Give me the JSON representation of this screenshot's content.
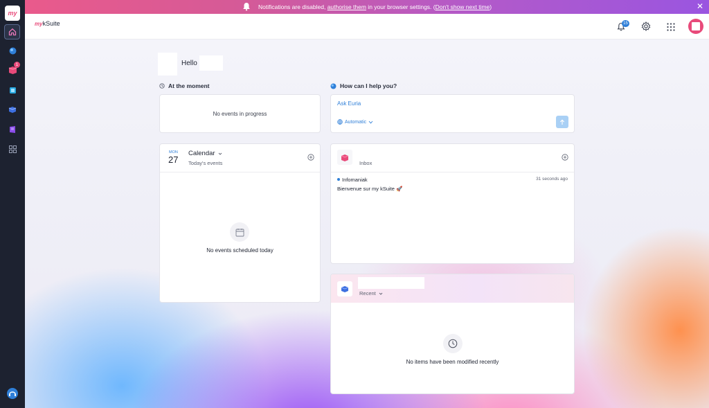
{
  "banner": {
    "text_before": "Notifications are disabled, ",
    "link_authorise": "authorise them",
    "text_middle": " in your browser settings. (",
    "link_dont_show": "Don't show next time",
    "text_after": ")"
  },
  "sidebar": {
    "notification_count": "1"
  },
  "header": {
    "logo_my": "my",
    "logo_ksuite": "kSuite",
    "notification_count": "15"
  },
  "greeting": {
    "hello": "Hello"
  },
  "at_the_moment": {
    "title": "At the moment",
    "empty": "No events in progress"
  },
  "assistant": {
    "title": "How can I help you?",
    "placeholder": "Ask Euria",
    "mode": "Automatic"
  },
  "calendar": {
    "month": "MON",
    "day": "27",
    "title": "Calendar",
    "subtitle": "Today's events",
    "empty": "No events scheduled today"
  },
  "mail": {
    "subtitle": "Inbox",
    "message": {
      "sender": "Infomaniak",
      "time": "31 seconds ago",
      "subject": "Bienvenue sur my kSuite 🚀"
    }
  },
  "drive": {
    "subtitle": "Recent",
    "empty": "No items have been modified recently"
  },
  "colors": {
    "sidebar_bg": "#1d2230",
    "accent_blue": "#2f7fd8",
    "brand_pink": "#e84a7a"
  }
}
